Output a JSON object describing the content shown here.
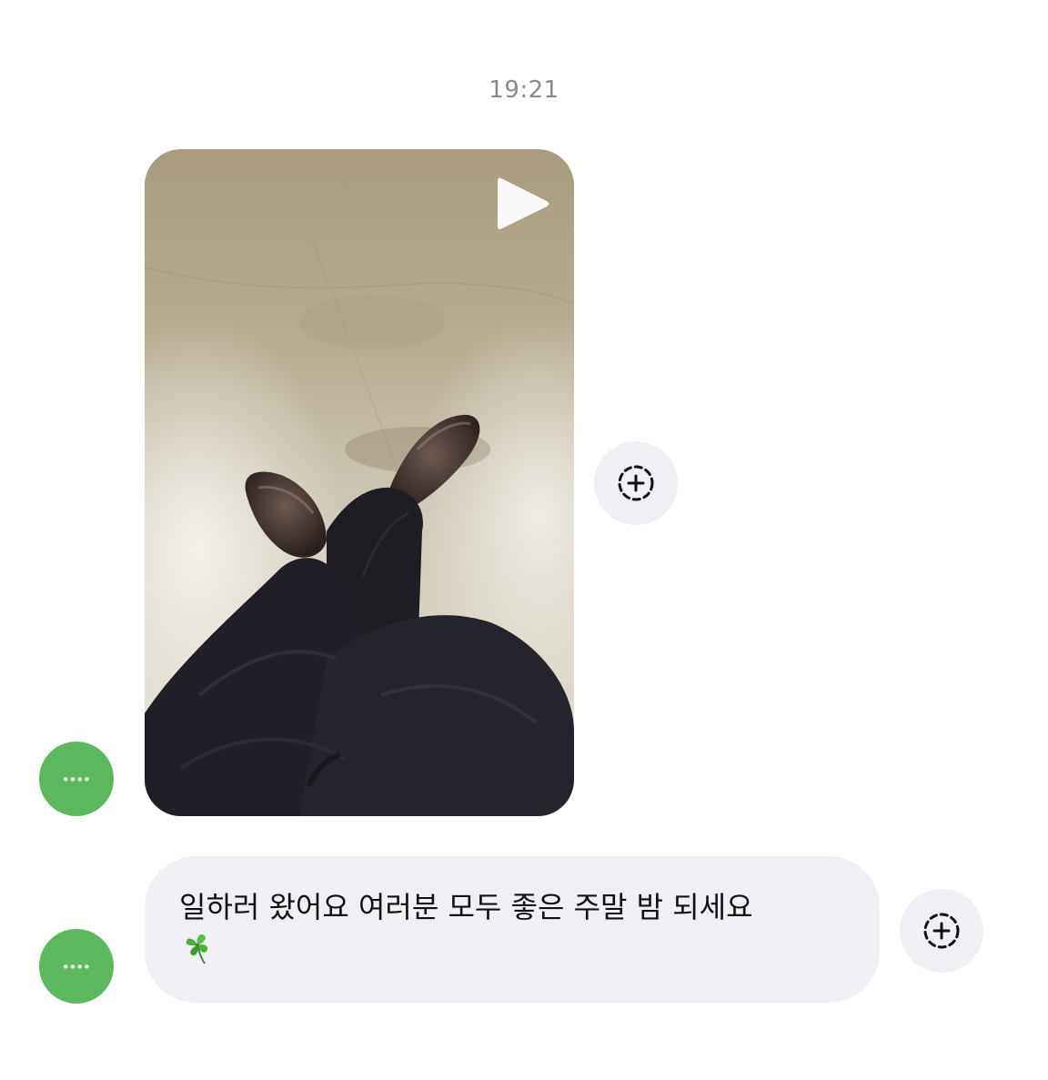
{
  "thread": {
    "timestamp": "19:21"
  },
  "messages": [
    {
      "type": "video",
      "sender_avatar_color": "#5cb85c",
      "play_icon": "play-icon",
      "action_icon": "add-to-story-icon"
    },
    {
      "type": "text",
      "text": "일하러 왔어요 여러분 모두 좋은 주말 밤 되세요",
      "emoji": "four-leaf-clover",
      "sender_avatar_color": "#5cb85c",
      "action_icon": "add-to-story-icon"
    }
  ],
  "colors": {
    "bubble_background": "#efeff4",
    "timestamp": "#8a8a8e",
    "avatar": "#5cb85c",
    "text": "#111111"
  }
}
